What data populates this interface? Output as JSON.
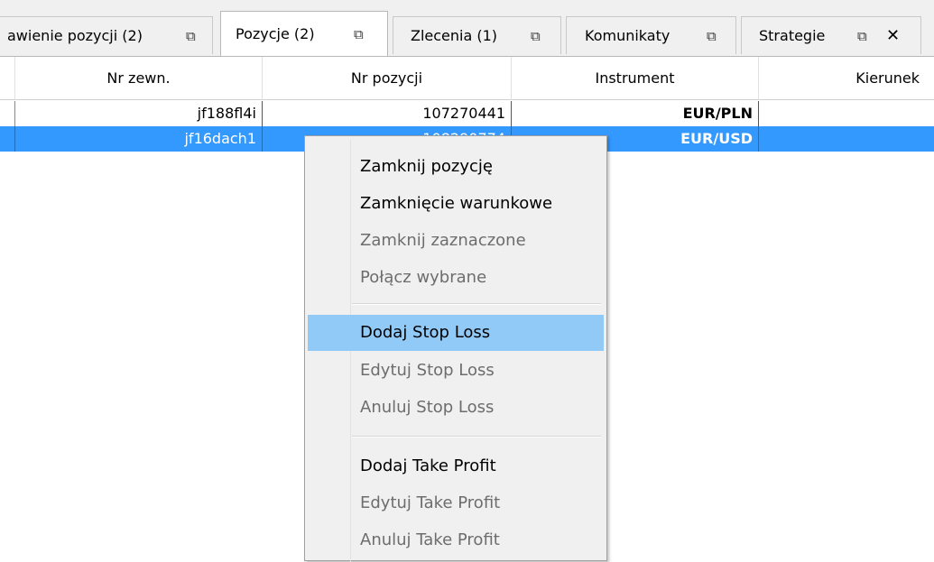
{
  "tabs": [
    {
      "label": "awienie pozycji (2)",
      "popout": "⧉",
      "active": false
    },
    {
      "label": "Pozycje (2)",
      "popout": "⧉",
      "active": true
    },
    {
      "label": "Zlecenia (1)",
      "popout": "⧉",
      "active": false
    },
    {
      "label": "Komunikaty",
      "popout": "⧉",
      "active": false
    },
    {
      "label": "Strategie",
      "popout": "⧉",
      "close": "✕",
      "active": false
    }
  ],
  "table": {
    "columns": [
      "Nr zewn.",
      "Nr pozycji",
      "Instrument",
      "Kierunek"
    ],
    "rows": [
      {
        "nr_zewn": "jf188fl4i",
        "nr_pozycji": "107270441",
        "instrument": "EUR/PLN",
        "selected": false
      },
      {
        "nr_zewn": "jf16dach1",
        "nr_pozycji": "108290774",
        "instrument": "EUR/USD",
        "selected": true
      }
    ]
  },
  "context_menu": {
    "items": [
      {
        "label": "Zamknij pozycję",
        "enabled": true
      },
      {
        "label": "Zamknięcie warunkowe",
        "enabled": true
      },
      {
        "label": "Zamknij zaznaczone",
        "enabled": false
      },
      {
        "label": "Połącz wybrane",
        "enabled": false
      },
      {
        "label": "Dodaj Stop Loss",
        "enabled": true,
        "hovered": true
      },
      {
        "label": "Edytuj Stop Loss",
        "enabled": false
      },
      {
        "label": "Anuluj Stop Loss",
        "enabled": false
      },
      {
        "label": "Dodaj Take Profit",
        "enabled": true
      },
      {
        "label": "Edytuj Take Profit",
        "enabled": false
      },
      {
        "label": "Anuluj Take Profit",
        "enabled": false
      }
    ]
  },
  "colors": {
    "selection": "#3399ff",
    "menu_hover": "#91c9f7",
    "menu_background": "#f0f0f0",
    "disabled_text": "#6d6d6d"
  }
}
